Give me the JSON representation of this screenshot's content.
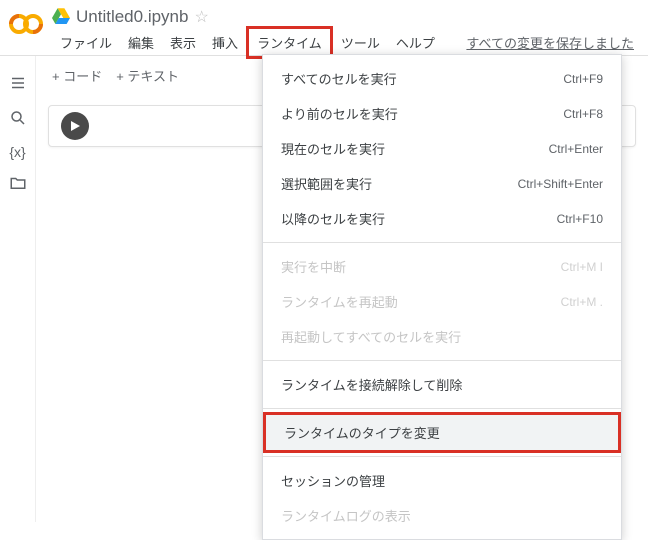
{
  "header": {
    "title": "Untitled0.ipynb",
    "save_status": "すべての変更を保存しました"
  },
  "menus": {
    "file": "ファイル",
    "edit": "編集",
    "view": "表示",
    "insert": "挿入",
    "runtime": "ランタイム",
    "tools": "ツール",
    "help": "ヘルプ"
  },
  "toolbar": {
    "code": "+ コード",
    "text": "+ テキスト"
  },
  "runtime_menu": {
    "run_all": {
      "label": "すべてのセルを実行",
      "shortcut": "Ctrl+F9"
    },
    "run_before": {
      "label": "より前のセルを実行",
      "shortcut": "Ctrl+F8"
    },
    "run_focused": {
      "label": "現在のセルを実行",
      "shortcut": "Ctrl+Enter"
    },
    "run_selection": {
      "label": "選択範囲を実行",
      "shortcut": "Ctrl+Shift+Enter"
    },
    "run_after": {
      "label": "以降のセルを実行",
      "shortcut": "Ctrl+F10"
    },
    "interrupt": {
      "label": "実行を中断",
      "shortcut": "Ctrl+M I"
    },
    "restart": {
      "label": "ランタイムを再起動",
      "shortcut": "Ctrl+M ."
    },
    "restart_run_all": {
      "label": "再起動してすべてのセルを実行",
      "shortcut": ""
    },
    "disconnect_delete": {
      "label": "ランタイムを接続解除して削除",
      "shortcut": ""
    },
    "change_type": {
      "label": "ランタイムのタイプを変更",
      "shortcut": ""
    },
    "manage_sessions": {
      "label": "セッションの管理",
      "shortcut": ""
    },
    "view_logs": {
      "label": "ランタイムログの表示",
      "shortcut": ""
    }
  }
}
